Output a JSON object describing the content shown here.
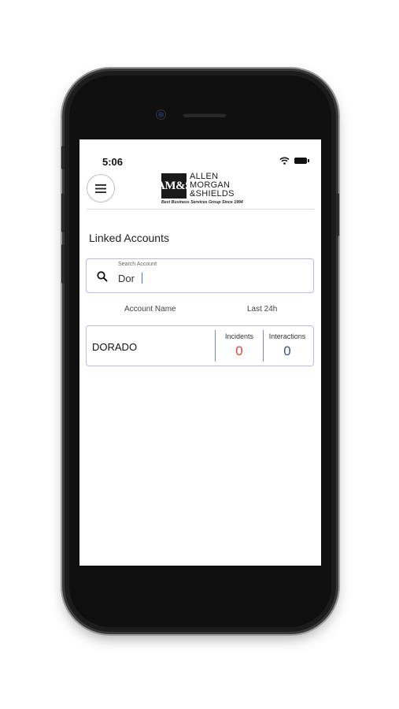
{
  "status_bar": {
    "time": "5:06"
  },
  "logo": {
    "monogram": "AM&S",
    "name_lines": "ALLEN\nMORGAN\n&SHIELDS",
    "tagline": "Best Business Services Group Since 1994"
  },
  "page": {
    "title": "Linked Accounts"
  },
  "search": {
    "label": "Search Account",
    "value": "Dor"
  },
  "columns": {
    "account_name": "Account Name",
    "last_24h": "Last 24h"
  },
  "accounts": [
    {
      "name": "DORADO",
      "incidents_label": "Incidents",
      "incidents": "0",
      "interactions_label": "Interactions",
      "interactions": "0"
    }
  ],
  "colors": {
    "incidents": "#e0483a",
    "interactions": "#3f4f8f",
    "border": "#b9bce0"
  },
  "icons": [
    "hamburger-menu-icon",
    "search-icon",
    "wifi-icon",
    "battery-icon"
  ]
}
